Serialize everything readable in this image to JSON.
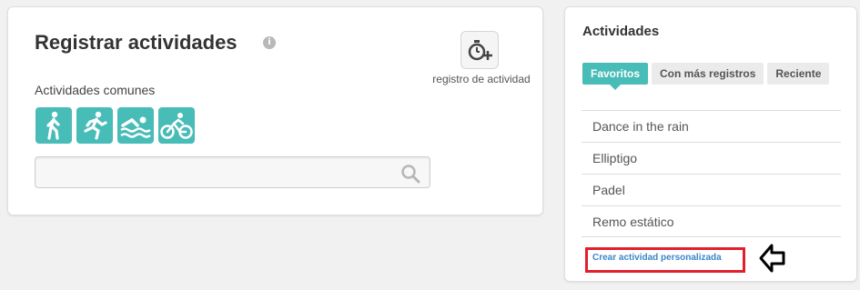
{
  "register": {
    "title": "Registrar actividades",
    "info_icon": "i",
    "timer_button_icon": "stopwatch-plus-icon",
    "timer_caption": "registro de actividad",
    "common_label": "Actividades comunes",
    "activity_icons": [
      "walking-icon",
      "running-icon",
      "swimming-icon",
      "cycling-icon"
    ],
    "search": {
      "value": "",
      "placeholder": "",
      "icon": "search-icon"
    }
  },
  "activities": {
    "title": "Actividades",
    "tabs": [
      {
        "label": "Favoritos",
        "active": true
      },
      {
        "label": "Con más registros",
        "active": false
      },
      {
        "label": "Reciente",
        "active": false
      }
    ],
    "favorites": [
      "Dance in the rain",
      "Elliptigo",
      "Padel",
      "Remo estático"
    ],
    "custom_link": "Crear actividad personalizada"
  },
  "annotation": {
    "highlight_color": "#e2202c",
    "arrow_icon": "left-arrow-icon"
  },
  "colors": {
    "accent": "#48bcb7",
    "link": "#3a86c8"
  }
}
